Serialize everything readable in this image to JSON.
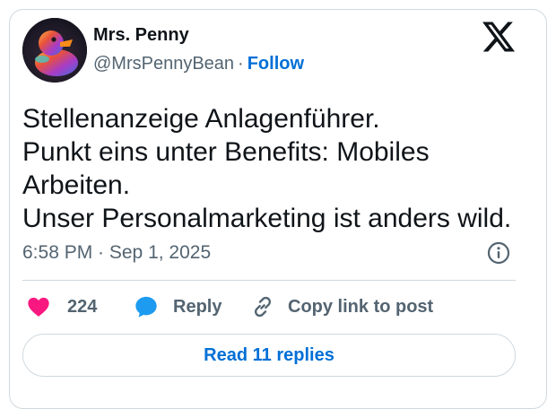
{
  "author": {
    "display_name": "Mrs. Penny",
    "handle": "@MrsPennyBean",
    "separator": "·",
    "follow_label": "Follow",
    "avatar_icon": "rubber-duck-avatar"
  },
  "brand": {
    "icon": "x-logo-icon",
    "color": "#0f1419"
  },
  "tweet": {
    "text": "Stellenanzeige Anlagenführer.\nPunkt eins unter Benefits: Mobiles Arbeiten.\nUnser Personalmarketing ist anders wild.",
    "timestamp": "6:58 PM · Sep 1, 2025",
    "info_icon": "info-icon"
  },
  "actions": {
    "like": {
      "icon": "heart-icon",
      "count": "224",
      "color": "#f91880"
    },
    "reply": {
      "icon": "speech-bubble-icon",
      "label": "Reply",
      "color": "#1d9bf0"
    },
    "copy": {
      "icon": "link-icon",
      "label": "Copy link to post"
    }
  },
  "footer": {
    "read_replies_label": "Read 11 replies"
  },
  "colors": {
    "link_blue": "#006fd6",
    "secondary_text": "#536471",
    "border": "#cfd9de"
  }
}
